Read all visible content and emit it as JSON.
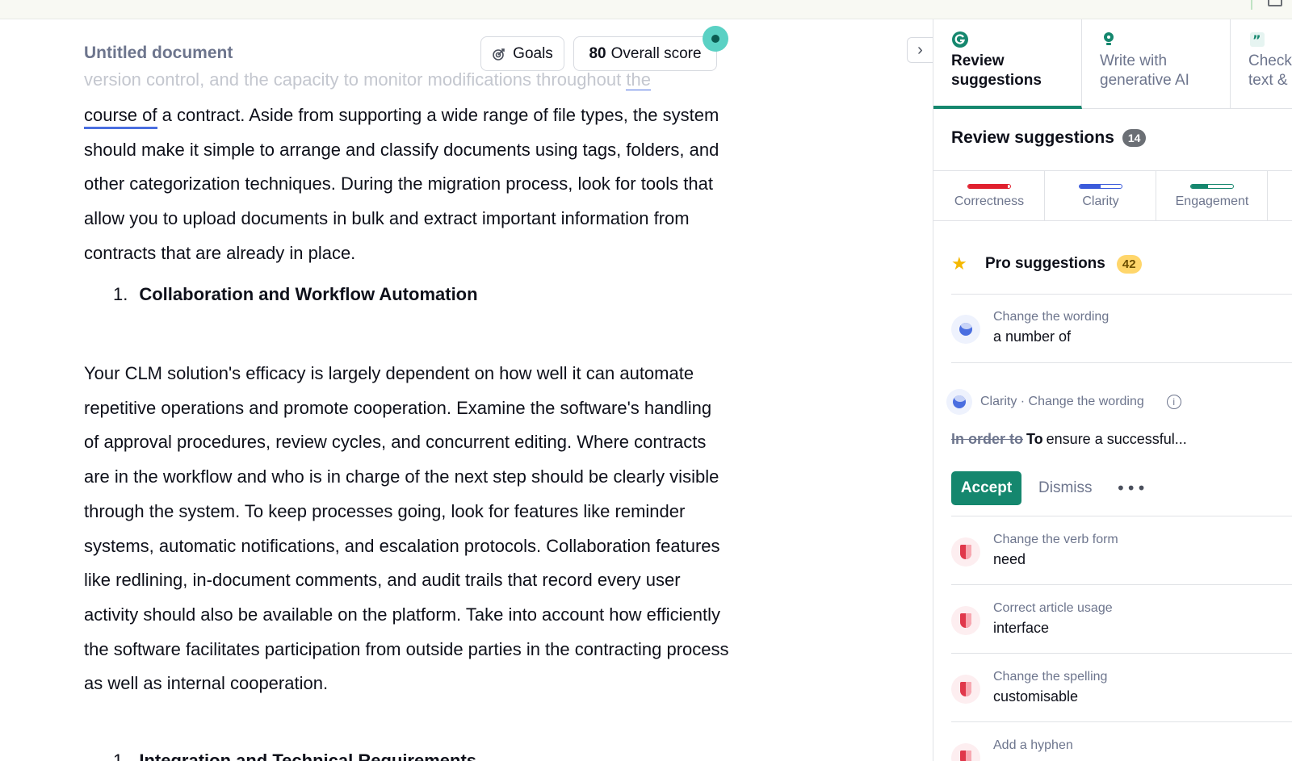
{
  "topbar": {},
  "editor": {
    "doc_title": "Untitled document",
    "goals_label": "Goals",
    "score_value": "80",
    "score_label": "Overall score",
    "faded_line_a": "version control, and the capacity to monitor modifications throughout ",
    "faded_line_b": "the",
    "p1_underlined": "course of",
    "p1_text": " a contract. Aside from supporting a wide range of file types, the system should make it simple to arrange and classify documents using tags, folders, and other categorization techniques. During the migration process, look for tools that allow you to upload documents in bulk and extract important information from contracts that are already in place.",
    "h1_num": "1.",
    "h1_text": "Collaboration and Workflow Automation",
    "p2_text": "Your CLM solution's efficacy is largely dependent on how well it can automate repetitive operations and promote cooperation. Examine the software's handling of approval procedures, review cycles, and concurrent editing. Where contracts are in the workflow and who is in charge of the next step should be clearly visible through the system. To keep processes going, look for features like reminder systems, automatic notifications, and escalation protocols. Collaboration features like redlining, in-document comments, and audit trails that record every user activity should also be available on the platform. Take into account how efficiently the software facilitates participation from outside parties in the contracting process as well as internal cooperation.",
    "h2_num": "1.",
    "h2_text": "Integration and Technical Requirements"
  },
  "sidebar": {
    "tabs": [
      {
        "label": "Review\nsuggestions",
        "icon": "grammarly-g-icon",
        "active": true
      },
      {
        "label": "Write with\ngenerative AI",
        "icon": "lightbulb-icon",
        "active": false
      },
      {
        "label": "Check\ntext &",
        "icon": "quote-icon",
        "active": false
      }
    ],
    "review_title": "Review suggestions",
    "review_count": "14",
    "categories": [
      {
        "label": "Correctness",
        "color": "#e0202e",
        "level": 0.95
      },
      {
        "label": "Clarity",
        "color": "#3b5bdb",
        "level": 0.5
      },
      {
        "label": "Engagement",
        "color": "#15876e",
        "level": 0.4
      }
    ],
    "pro_label": "Pro suggestions",
    "pro_count": "42",
    "suggestions": [
      {
        "kind": "Change the wording",
        "value": "a number of",
        "type": "clarity"
      },
      {
        "kind": "Change the verb form",
        "value": "need",
        "type": "correctness"
      },
      {
        "kind": "Correct article usage",
        "value": "interface",
        "type": "correctness"
      },
      {
        "kind": "Change the spelling",
        "value": "customisable",
        "type": "correctness"
      },
      {
        "kind": "Add a hyphen",
        "value": "",
        "type": "correctness"
      }
    ],
    "expanded": {
      "kind": "Clarity · Change the wording",
      "deleted": "In order to",
      "inserted": "To",
      "rest": "ensure a successful...",
      "accept": "Accept",
      "dismiss": "Dismiss",
      "more": "•••"
    }
  }
}
